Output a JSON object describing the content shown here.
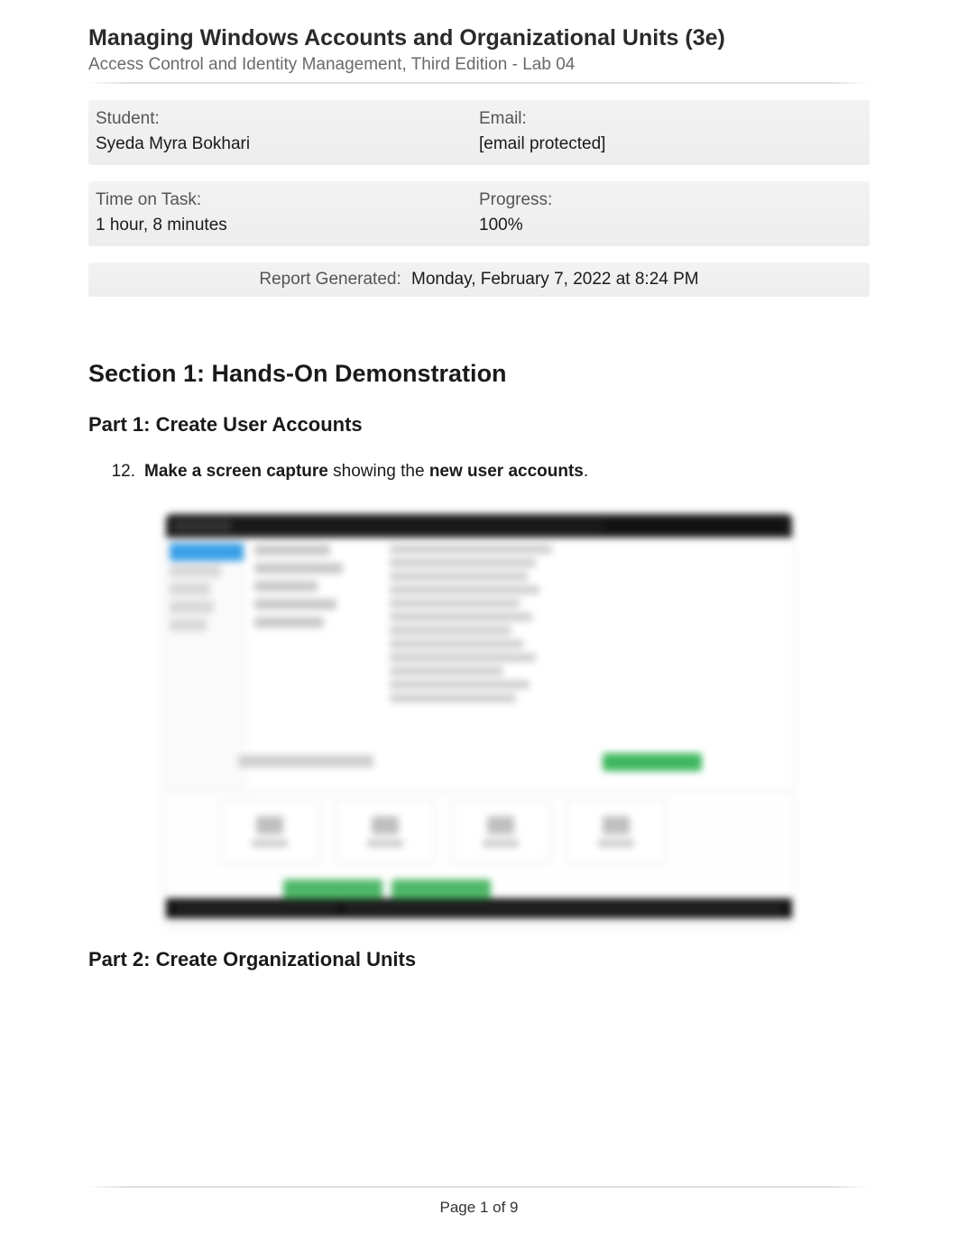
{
  "header": {
    "title": "Managing Windows Accounts and Organizational Units (3e)",
    "subtitle": "Access Control and Identity Management, Third Edition - Lab 04"
  },
  "info": {
    "student_label": "Student:",
    "student_value": "Syeda Myra Bokhari",
    "email_label": "Email:",
    "email_value": "[email protected]",
    "time_label": "Time on Task:",
    "time_value": "1 hour, 8 minutes",
    "progress_label": "Progress:",
    "progress_value": "100%"
  },
  "report": {
    "generated_label": "Report Generated:",
    "generated_value": "Monday, February 7, 2022 at 8:24 PM"
  },
  "section": {
    "heading": "Section 1: Hands-On Demonstration",
    "part1_heading": "Part 1: Create User Accounts",
    "task_number": "12.",
    "task_bold1": "Make a screen capture",
    "task_mid": " showing the ",
    "task_bold2": "new user accounts",
    "task_end": ".",
    "part2_heading": "Part 2: Create Organizational Units"
  },
  "footer": {
    "page_text": "Page 1 of 9"
  }
}
